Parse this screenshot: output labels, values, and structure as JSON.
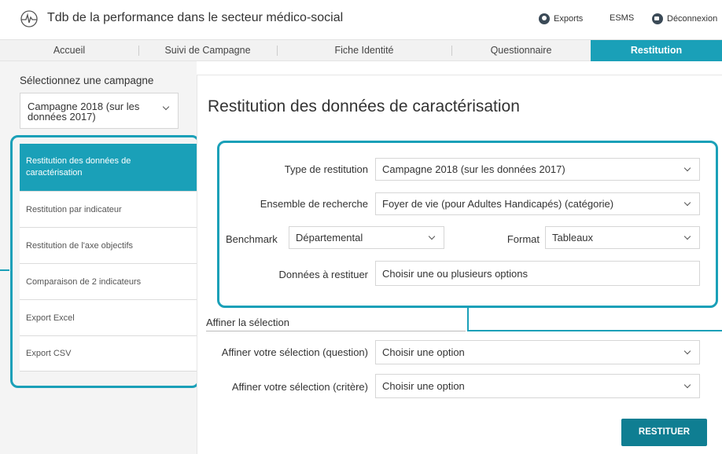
{
  "header": {
    "title": "Tdb de la performance dans le secteur médico-social",
    "exports_label": "Exports",
    "esms_label": "ESMS",
    "logout_label": "Déconnexion"
  },
  "nav": {
    "tabs": [
      "Accueil",
      "Suivi de Campagne",
      "Fiche Identité",
      "Questionnaire",
      "Restitution"
    ],
    "active": "Restitution"
  },
  "sidebar": {
    "select_title": "Sélectionnez une campagne",
    "campaign_value": "Campagne 2018 (sur les données 2017)",
    "items": [
      {
        "label": "Restitution des données de caractérisation",
        "active": true
      },
      {
        "label": "Restitution par indicateur"
      },
      {
        "label": "Restitution de l'axe objectifs"
      },
      {
        "label": "Comparaison de 2 indicateurs"
      },
      {
        "label": "Export Excel"
      },
      {
        "label": "Export CSV"
      }
    ]
  },
  "main": {
    "title": "Restitution des données de caractérisation",
    "form": {
      "type_label": "Type de restitution",
      "type_value": "Campagne 2018 (sur les données 2017)",
      "ensemble_label": "Ensemble de recherche",
      "ensemble_value": "Foyer de vie (pour Adultes Handicapés) (catégorie)",
      "benchmark_label": "Benchmark",
      "benchmark_value": "Départemental",
      "format_label": "Format",
      "format_value": "Tableaux",
      "donnees_label": "Données à restituer",
      "donnees_placeholder": "Choisir une ou plusieurs options"
    },
    "refine": {
      "title": "Affiner la sélection",
      "question_label": "Affiner votre sélection (question)",
      "question_value": "Choisir une option",
      "critere_label": "Affiner votre sélection (critère)",
      "critere_value": "Choisir une option"
    },
    "submit_label": "RESTITUER"
  },
  "colors": {
    "accent": "#1aa0b8",
    "button": "#0f7e92"
  }
}
